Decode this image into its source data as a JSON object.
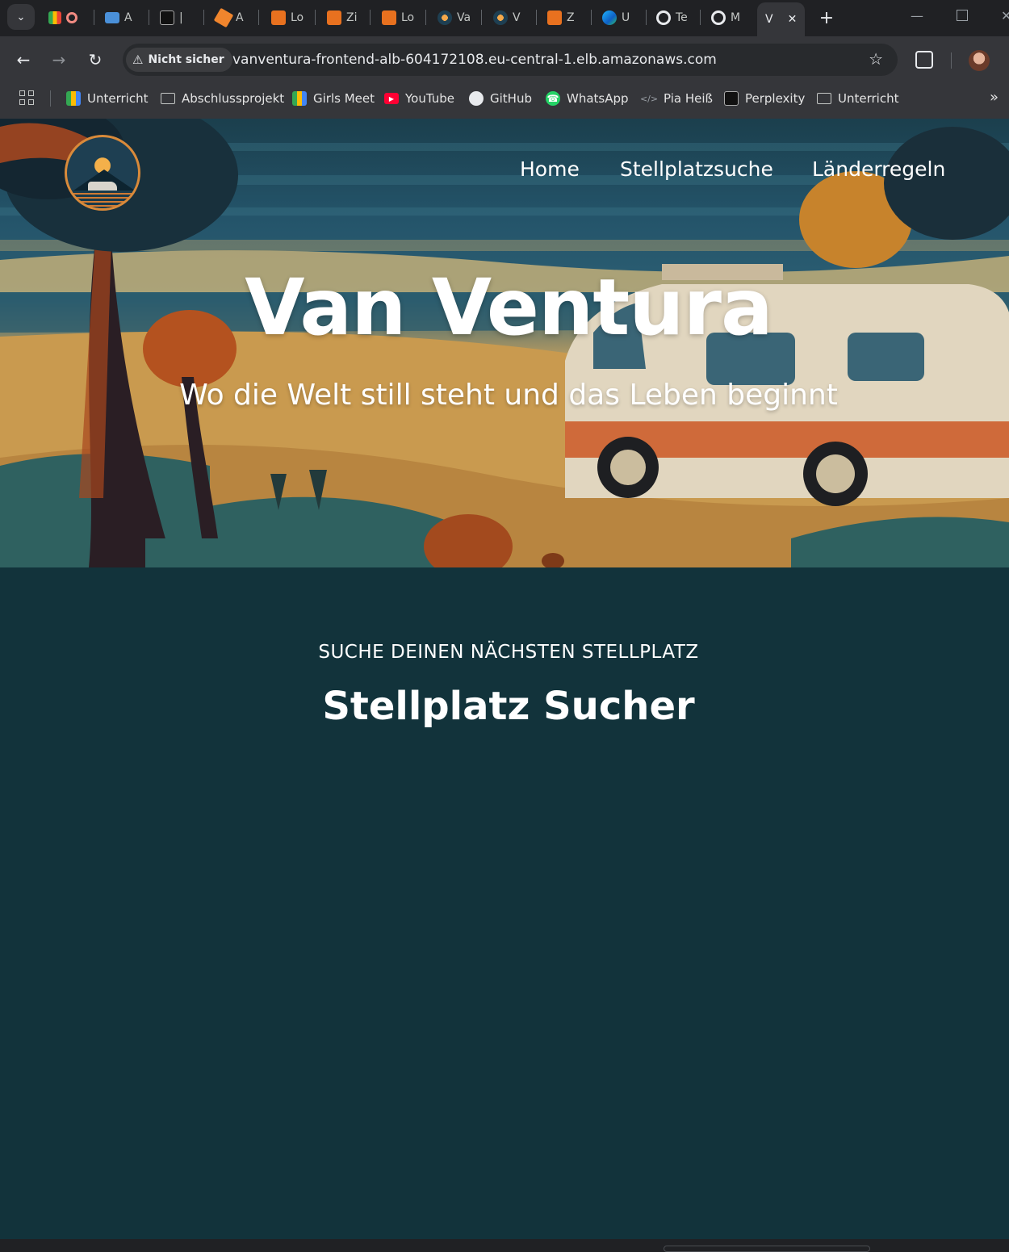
{
  "browser": {
    "tabs": [
      {
        "label": "",
        "icon": "meet-record-icon"
      },
      {
        "label": "A",
        "icon": "remote-desktop-icon"
      },
      {
        "label": "|",
        "icon": "perplexity-icon"
      },
      {
        "label": "A",
        "icon": "aws-cube-icon"
      },
      {
        "label": "Lo",
        "icon": "aws-console-icon"
      },
      {
        "label": "Zi",
        "icon": "aws-console-icon"
      },
      {
        "label": "Lo",
        "icon": "aws-console-icon"
      },
      {
        "label": "Va",
        "icon": "vanventura-icon"
      },
      {
        "label": "V",
        "icon": "vanventura-icon"
      },
      {
        "label": "Z",
        "icon": "aws-console-icon"
      },
      {
        "label": "U",
        "icon": "edge-icon"
      },
      {
        "label": "Te",
        "icon": "github-copilot-icon"
      },
      {
        "label": "M",
        "icon": "github-copilot-icon"
      },
      {
        "label": "V",
        "icon": "vanventura-icon",
        "active": true
      }
    ],
    "security_label": "Nicht sicher",
    "url": "vanventura-frontend-alb-604172108.eu-central-1.elb.amazonaws.com",
    "bookmarks": [
      {
        "label": "Unterricht",
        "icon": "google-meet-icon"
      },
      {
        "label": "Abschlussprojekt",
        "icon": "folder-icon"
      },
      {
        "label": "Girls Meet",
        "icon": "google-meet-icon"
      },
      {
        "label": "YouTube",
        "icon": "youtube-icon"
      },
      {
        "label": "GitHub",
        "icon": "github-icon"
      },
      {
        "label": "WhatsApp",
        "icon": "whatsapp-icon"
      },
      {
        "label": "Pia Heiß",
        "icon": "code-icon"
      },
      {
        "label": "Perplexity",
        "icon": "perplexity-icon"
      },
      {
        "label": "Unterricht",
        "icon": "folder-icon"
      }
    ]
  },
  "site": {
    "nav": [
      "Home",
      "Stellplatzsuche",
      "Länderregeln"
    ],
    "hero_title": "Van Ventura",
    "hero_subtitle": "Wo die Welt still steht und das Leben beginnt",
    "section_eyebrow": "SUCHE DEINEN NÄCHSTEN STELLPLATZ",
    "section_title": "Stellplatz Sucher"
  },
  "colors": {
    "page_background": "#12333b",
    "chrome_dark": "#202124",
    "chrome_toolbar": "#35363a"
  }
}
